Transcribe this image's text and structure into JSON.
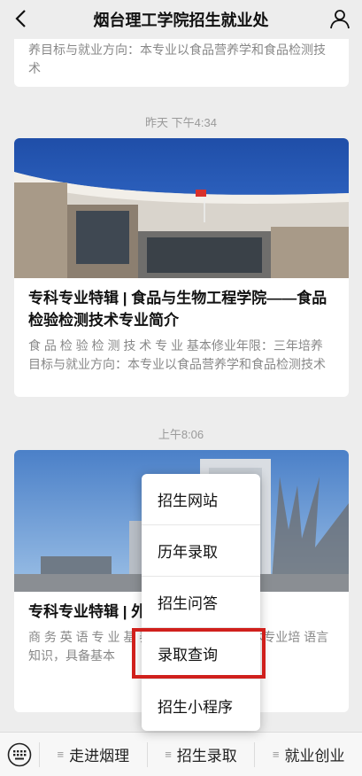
{
  "header": {
    "title": "烟台理工学院招生就业处",
    "back_icon": "chevron-left-icon",
    "profile_icon": "user-icon"
  },
  "articles": [
    {
      "desc": "养目标与就业方向：本专业以食品营养学和食品检测技术"
    },
    {
      "timestamp": "昨天 下午4:34",
      "title": "专科专业特辑 | 食品与生物工程学院——食品检验检测技术专业简介",
      "desc": "食 品 检 验 检 测 技 术 专 业 基本修业年限：三年培养目标与就业方向：本专业以食品营养学和食品检测技术"
    },
    {
      "timestamp": "上午8:06",
      "title": "专科专业特辑 | 外 务英语专业简介",
      "desc": "商 务 英 语 专 业 基 养目标与就业方向：本专业培 语言知识，具备基本"
    }
  ],
  "popup_menu": {
    "items": [
      "招生网站",
      "历年录取",
      "招生问答",
      "录取查询",
      "招生小程序"
    ],
    "highlighted": "录取查询",
    "highlight_color": "#d0201c"
  },
  "bottom_bar": {
    "keyboard_icon": "keyboard-icon",
    "tabs": [
      "走进烟理",
      "招生录取",
      "就业创业"
    ]
  }
}
